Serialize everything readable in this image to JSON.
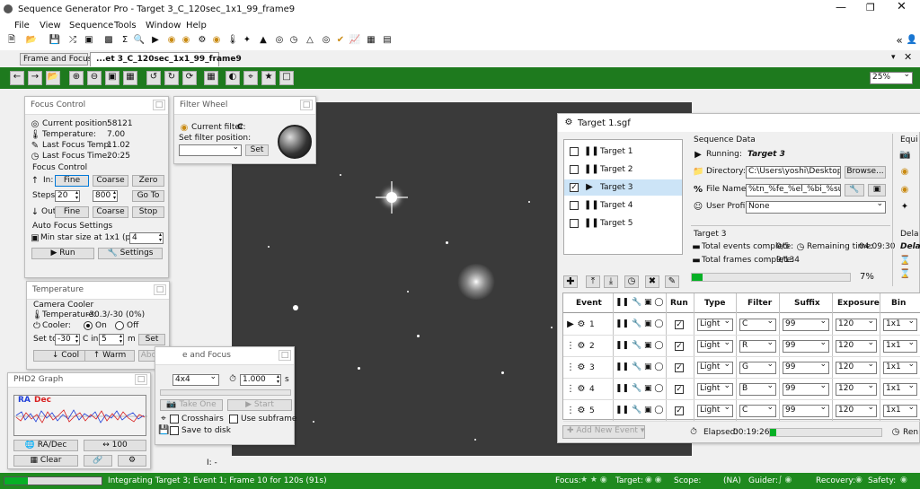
{
  "window": {
    "title": "Sequence Generator Pro - Target 3_C_120sec_1x1_99_frame9"
  },
  "menu": [
    "File",
    "View",
    "Sequence",
    "Tools",
    "Window",
    "Help"
  ],
  "tabs": {
    "frame_focus": "Frame and Focus",
    "image": "...et 3_C_120sec_1x1_99_frame9"
  },
  "zoom": "25%",
  "focus_control": {
    "title": "Focus Control",
    "current_position_label": "Current position:",
    "current_position": "58121",
    "temperature_label": "Temperature:",
    "temperature": "7.00",
    "last_temp_label": "Last Focus Temp:",
    "last_temp": "11.02",
    "last_time_label": "Last Focus Time:",
    "last_time": "20:25",
    "section": "Focus Control",
    "in_label": "In:",
    "fine": "Fine",
    "coarse": "Coarse",
    "zero": "Zero",
    "steps_label": "Steps:",
    "steps_fine": "20",
    "steps_coarse": "800",
    "goto": "Go To",
    "out_label": "Out:",
    "stop": "Stop",
    "af_section": "Auto Focus Settings",
    "min_star_label": "Min star size at 1x1 (px):",
    "min_star": "4",
    "run": "Run",
    "settings": "Settings"
  },
  "filter_wheel": {
    "title": "Filter Wheel",
    "current_filter_label": "Current filter:",
    "current_filter": "C",
    "set_position_label": "Set filter position:",
    "set": "Set"
  },
  "temperature_panel": {
    "title": "Temperature",
    "camera_cooler": "Camera Cooler",
    "temp_label": "Temperature:",
    "temp_value": "-30.3/-30 (0%)",
    "cooler_label": "Cooler:",
    "on": "On",
    "off": "Off",
    "set_to_label": "Set to",
    "set_to": "-30",
    "c_in": "C in",
    "minutes": "5",
    "m": "m",
    "set": "Set",
    "cool": "Cool",
    "warm": "Warm",
    "abort": "Abort"
  },
  "frame_focus_panel": {
    "title": "e and Focus",
    "binning": "4x4",
    "exposure": "1.000",
    "s": "s",
    "take_one": "Take One",
    "start": "Start",
    "crosshairs": "Crosshairs",
    "use_subframe": "Use subframe",
    "save_to_disk": "Save to disk"
  },
  "phd_graph": {
    "title": "PHD2 Graph",
    "ra": "RA",
    "dec": "Dec",
    "ra_dec_button": "RA/Dec",
    "scale": "100",
    "clear": "Clear",
    "colors": {
      "ra": "#1f3fd8",
      "dec": "#d81f1f"
    }
  },
  "sequence": {
    "title": "Target 1.sgf",
    "targets": [
      {
        "name": "Target 1",
        "checked": false,
        "running": false
      },
      {
        "name": "Target 2",
        "checked": false,
        "running": false
      },
      {
        "name": "Target 3",
        "checked": true,
        "running": true
      },
      {
        "name": "Target 4",
        "checked": false,
        "running": false
      },
      {
        "name": "Target 5",
        "checked": false,
        "running": false
      }
    ],
    "data_label": "Sequence Data",
    "running_label": "Running:",
    "running_value": "Target 3",
    "directory_label": "Directory:",
    "directory": "C:\\Users\\yoshi\\Desktop\\sg",
    "browse": "Browse...",
    "file_name_label": "File Name:",
    "file_name": "%tn_%fe_%el_%bi_%su_%fn",
    "user_profile_label": "User Profile:",
    "user_profile": "None",
    "target_section": "Target 3",
    "total_events_label": "Total events complete:",
    "total_events": "0/5",
    "remaining_label": "Remaining time:",
    "remaining": "04:09:30",
    "total_frames_label": "Total frames complete:",
    "total_frames": "9/134",
    "progress": 0.07,
    "progress_text": "7%",
    "columns": [
      "Event",
      "Run",
      "Type",
      "Filter",
      "Suffix",
      "Exposure",
      "Bin"
    ],
    "events": [
      {
        "n": "1",
        "type": "Light",
        "filter": "C",
        "suffix": "99",
        "exposure": "120",
        "bin": "1x1",
        "running": true
      },
      {
        "n": "2",
        "type": "Light",
        "filter": "R",
        "suffix": "99",
        "exposure": "120",
        "bin": "1x1",
        "running": false
      },
      {
        "n": "3",
        "type": "Light",
        "filter": "G",
        "suffix": "99",
        "exposure": "120",
        "bin": "1x1",
        "running": false
      },
      {
        "n": "4",
        "type": "Light",
        "filter": "B",
        "suffix": "99",
        "exposure": "120",
        "bin": "1x1",
        "running": false
      },
      {
        "n": "5",
        "type": "Light",
        "filter": "C",
        "suffix": "99",
        "exposure": "120",
        "bin": "1x1",
        "running": false
      }
    ],
    "add_new_event": "Add New Event",
    "elapsed_label": "Elapsed:",
    "elapsed": "00:19:26",
    "equip": "Equi",
    "delay": "Dela",
    "delay2": "Dela",
    "rec": "Ren"
  },
  "image_coords": "I: -",
  "status": {
    "message": "Integrating Target 3; Event 1; Frame 10 for 120s (91s)",
    "focus": "Focus:",
    "target": "Target:",
    "scope": "Scope:",
    "scope_value": "(NA)",
    "guider": "Guider:",
    "recovery": "Recovery:",
    "safety": "Safety:",
    "color": "#1f8a1f"
  }
}
